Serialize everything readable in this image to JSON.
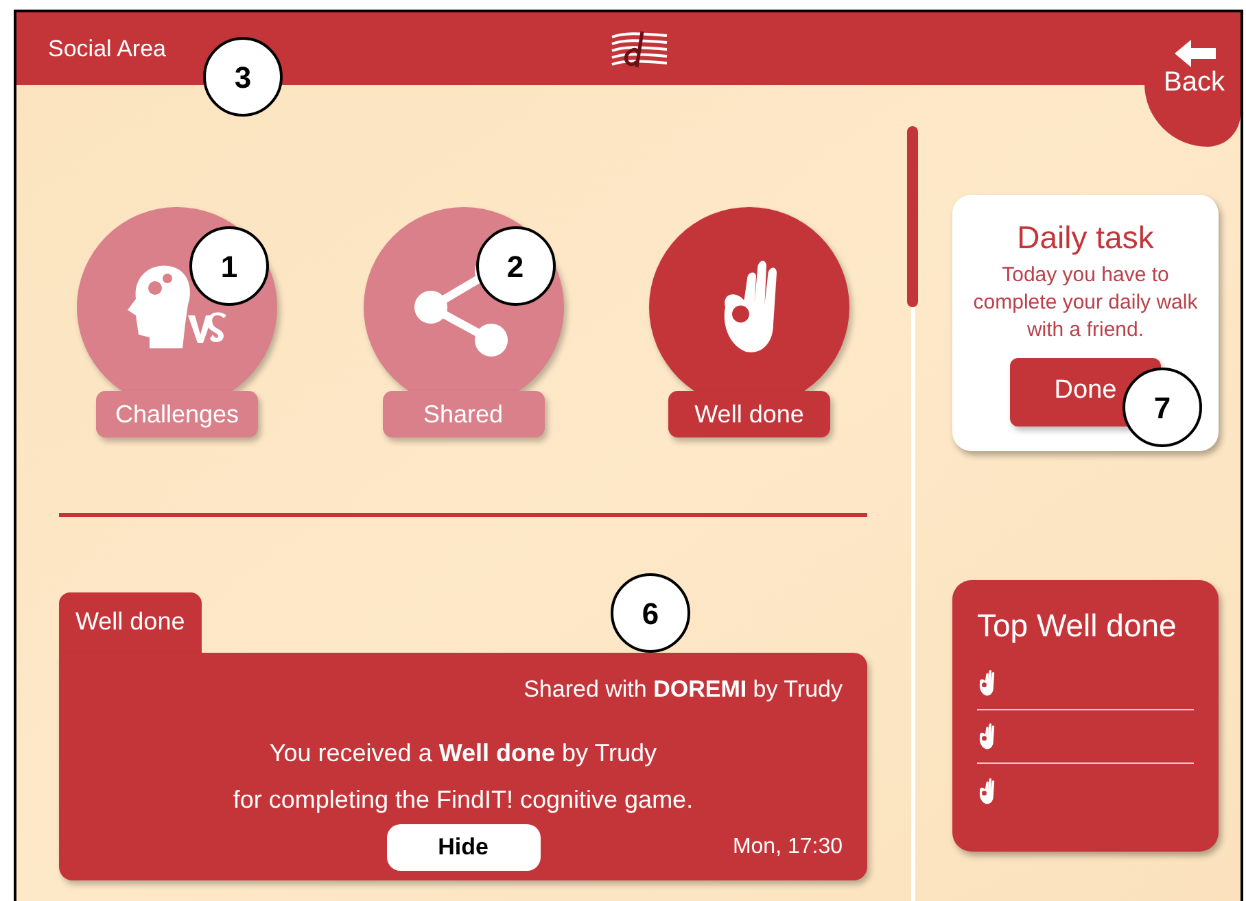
{
  "header": {
    "title": "Social Area",
    "back": "Back",
    "callout": "3"
  },
  "tabs": [
    {
      "label": "Challenges",
      "kind": "head-vs",
      "selected": false,
      "callout": "1"
    },
    {
      "label": "Shared",
      "kind": "share",
      "selected": false,
      "callout": "2"
    },
    {
      "label": "Well done",
      "kind": "ok-hand",
      "selected": true
    }
  ],
  "feed": {
    "callout": "6",
    "cards": [
      {
        "tab": "Well done",
        "shared": "Shared with **DOREMI** by Trudy",
        "message_lines": [
          "You received a **Well done** by Trudy",
          "for completing the FindIT! cognitive game."
        ],
        "hide": "Hide",
        "time": "Mon, 17:30"
      }
    ]
  },
  "daily_task": {
    "title": "Daily task",
    "text": "Today you have to complete your daily walk with a friend.",
    "button": "Done",
    "callout": "7"
  },
  "top_well_done": {
    "title": "Top Well done",
    "rows": [
      {
        "kind": "ok-hand"
      },
      {
        "kind": "ok-hand"
      },
      {
        "kind": "ok-hand"
      }
    ]
  }
}
